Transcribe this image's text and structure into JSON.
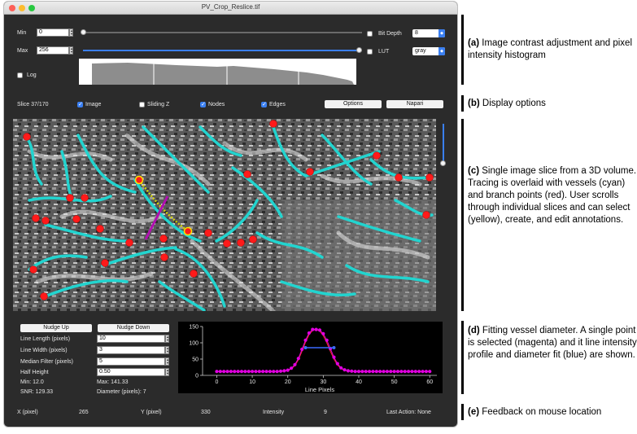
{
  "window": {
    "title": "PV_Crop_Reslice.tif"
  },
  "contrast": {
    "min_label": "Min",
    "min_value": "0",
    "max_label": "Max",
    "max_value": "256",
    "min_level": 0.0,
    "max_level": 1.0,
    "bit_depth_label": "Bit Depth",
    "bit_depth_value": "8",
    "lut_label": "LUT",
    "lut_value": "gray",
    "log_label": "Log"
  },
  "display": {
    "slice_label": "Slice 37/170",
    "image_label": "Image",
    "image_checked": true,
    "sliding_z_label": "Sliding Z",
    "sliding_z_checked": false,
    "nodes_label": "Nodes",
    "nodes_checked": true,
    "edges_label": "Edges",
    "edges_checked": true,
    "options_button": "Options",
    "napari_button": "Napari"
  },
  "fit": {
    "nudge_up": "Nudge Up",
    "nudge_down": "Nudge Down",
    "line_length_label": "Line Length (pixels)",
    "line_length_value": "10",
    "line_width_label": "Line Width (pixels)",
    "line_width_value": "3",
    "median_filter_label": "Median Filter (pixels)",
    "median_filter_value": "5",
    "half_height_label": "Half Height",
    "half_height_value": "0.50",
    "min_text": "Min: 12.0",
    "max_text": "Max: 141.33",
    "snr_text": "SNR: 129.33",
    "diameter_text": "Diameter (pixels): 7"
  },
  "status": {
    "x_label": "X (pixel)",
    "x_value": "265",
    "y_label": "Y (pixel)",
    "y_value": "330",
    "intensity_label": "Intensity",
    "intensity_value": "9",
    "last_action": "Last Action: None"
  },
  "chart_data": {
    "type": "line",
    "xlabel": "Line Pixels",
    "ylabel": "",
    "xlim": [
      -4,
      62
    ],
    "ylim": [
      0,
      150
    ],
    "xticks": [
      0,
      10,
      20,
      30,
      40,
      50,
      60
    ],
    "yticks": [
      0,
      50,
      100,
      150
    ],
    "colors": {
      "points": "#e000e0",
      "fit": "#ff2a2a",
      "diameter": "#3a6bff"
    },
    "x": [
      0,
      1,
      2,
      3,
      4,
      5,
      6,
      7,
      8,
      9,
      10,
      11,
      12,
      13,
      14,
      15,
      16,
      17,
      18,
      19,
      20,
      21,
      22,
      23,
      24,
      25,
      26,
      27,
      28,
      29,
      30,
      31,
      32,
      33,
      34,
      35,
      36,
      37,
      38,
      39,
      40,
      41,
      42,
      43,
      44,
      45,
      46,
      47,
      48,
      49,
      50,
      51,
      52,
      53,
      54,
      55,
      56,
      57,
      58,
      59,
      60
    ],
    "series": [
      {
        "values": [
          12,
          12,
          12,
          12,
          12,
          12,
          12,
          12,
          12,
          12,
          12,
          12,
          12,
          12,
          12,
          12,
          12,
          12,
          13,
          14,
          16,
          22,
          33,
          52,
          80,
          108,
          130,
          141,
          141,
          139,
          128,
          108,
          82,
          56,
          36,
          23,
          17,
          14,
          13,
          12,
          12,
          12,
          12,
          12,
          12,
          12,
          12,
          12,
          12,
          12,
          12,
          12,
          12,
          12,
          12,
          12,
          12,
          12,
          12,
          12,
          12
        ]
      },
      {
        "values": [
          12,
          12,
          12,
          12,
          12,
          12,
          12,
          12,
          12,
          12,
          12,
          12,
          12,
          12,
          12,
          12,
          12,
          12,
          12,
          13,
          15,
          20,
          30,
          48,
          74,
          102,
          125,
          138,
          141,
          136,
          122,
          100,
          74,
          50,
          32,
          21,
          16,
          13,
          12,
          12,
          12,
          12,
          12,
          12,
          12,
          12,
          12,
          12,
          12,
          12,
          12,
          12,
          12,
          12,
          12,
          12,
          12,
          12,
          12,
          12,
          12
        ]
      }
    ],
    "diameter_segment": {
      "x": [
        25,
        33
      ],
      "y": 85
    }
  },
  "callouts": [
    {
      "tag": "(a)",
      "text": "Image contrast adjustment and pixel intensity histogram"
    },
    {
      "tag": "(b)",
      "text": "Display options"
    },
    {
      "tag": "(c)",
      "text": "Single image slice from a 3D volume. Tracing is overlaid with vessels (cyan) and branch points (red). User scrolls through individual slices and can select (yellow), create, and edit annotations."
    },
    {
      "tag": "(d)",
      "text": "Fitting vessel diameter. A single point is selected (magenta) and it line intensity profile and diameter fit (blue) are shown."
    },
    {
      "tag": "(e)",
      "text": "Feedback on mouse location"
    }
  ]
}
